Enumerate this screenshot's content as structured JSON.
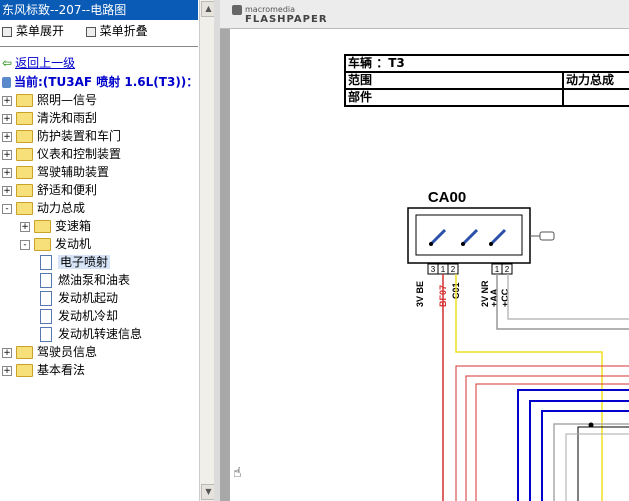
{
  "window_title": "东风标致--207--电路图",
  "menu": {
    "expand_label": "菜单展开",
    "collapse_label": "菜单折叠"
  },
  "back_link": "返回上一级",
  "current": "当前:(TU3AF 喷射 1.6L(T3))：",
  "tree": [
    {
      "label": "照明—信号",
      "level": 0,
      "type": "folder",
      "sign": "+"
    },
    {
      "label": "清洗和雨刮",
      "level": 0,
      "type": "folder",
      "sign": "+"
    },
    {
      "label": "防护装置和车门",
      "level": 0,
      "type": "folder",
      "sign": "+"
    },
    {
      "label": "仪表和控制装置",
      "level": 0,
      "type": "folder",
      "sign": "+"
    },
    {
      "label": "驾驶辅助装置",
      "level": 0,
      "type": "folder",
      "sign": "+"
    },
    {
      "label": "舒适和便利",
      "level": 0,
      "type": "folder",
      "sign": "+"
    },
    {
      "label": "动力总成",
      "level": 0,
      "type": "folder",
      "sign": "-"
    },
    {
      "label": "变速箱",
      "level": 1,
      "type": "folder",
      "sign": "+"
    },
    {
      "label": "发动机",
      "level": 1,
      "type": "folder",
      "sign": "-"
    },
    {
      "label": "电子喷射",
      "level": 2,
      "type": "doc",
      "selected": true
    },
    {
      "label": "燃油泵和油表",
      "level": 2,
      "type": "doc"
    },
    {
      "label": "发动机起动",
      "level": 2,
      "type": "doc"
    },
    {
      "label": "发动机冷却",
      "level": 2,
      "type": "doc"
    },
    {
      "label": "发动机转速信息",
      "level": 2,
      "type": "doc"
    },
    {
      "label": "驾驶员信息",
      "level": 0,
      "type": "folder",
      "sign": "+"
    },
    {
      "label": "基本看法",
      "level": 0,
      "type": "folder",
      "sign": "+"
    }
  ],
  "viewer": {
    "logo_top": "macromedia",
    "logo_bottom": "FLASHPAPER",
    "header": {
      "vehicle_label": "车辆",
      "vehicle_value": "：T3",
      "range_label": "范围",
      "range_value": "动力总成",
      "part_label": "部件"
    },
    "diagram": {
      "component": "CA00",
      "pins_left": [
        "3",
        "1",
        "2"
      ],
      "pins_right": [
        "1",
        "2"
      ],
      "wire_labels": [
        "3V BE",
        "BF07",
        "C01",
        "2V NR",
        "+AA",
        "+CC"
      ]
    }
  },
  "colors": {
    "title_bar": "#0a5bb5",
    "link": "#0000cc",
    "wire_red": "#d43030",
    "wire_yellow": "#f2e020",
    "wire_blue": "#0000cc"
  }
}
